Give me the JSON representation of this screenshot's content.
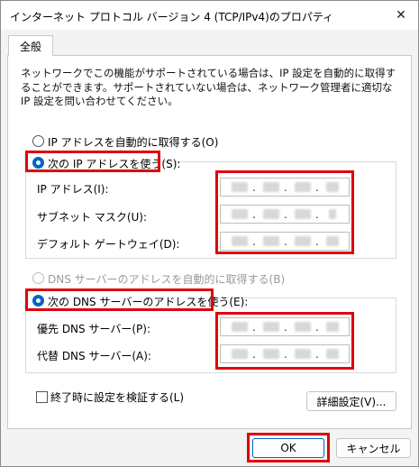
{
  "window": {
    "title": "インターネット プロトコル バージョン 4 (TCP/IPv4)のプロパティ",
    "close_glyph": "✕"
  },
  "tabs": [
    {
      "label": "全般"
    }
  ],
  "description": "ネットワークでこの機能がサポートされている場合は、IP 設定を自動的に取得することができます。サポートされていない場合は、ネットワーク管理者に適切な IP 設定を問い合わせてください。",
  "ip_section": {
    "auto_option": "IP アドレスを自動的に取得する(O)",
    "manual_option": "次の IP アドレスを使う(S):",
    "fields": [
      {
        "label": "IP アドレス(I):"
      },
      {
        "label": "サブネット マスク(U):"
      },
      {
        "label": "デフォルト ゲートウェイ(D):"
      }
    ]
  },
  "dns_section": {
    "auto_option": "DNS サーバーのアドレスを自動的に取得する(B)",
    "manual_option": "次の DNS サーバーのアドレスを使う(E):",
    "fields": [
      {
        "label": "優先 DNS サーバー(P):"
      },
      {
        "label": "代替 DNS サーバー(A):"
      }
    ]
  },
  "validate_checkbox": "終了時に設定を検証する(L)",
  "advanced_button": "詳細設定(V)...",
  "ok_button": "OK",
  "cancel_button": "キャンセル",
  "ip_separator": ".",
  "colors": {
    "highlight": "#e0000b",
    "accent": "#0067c0"
  }
}
